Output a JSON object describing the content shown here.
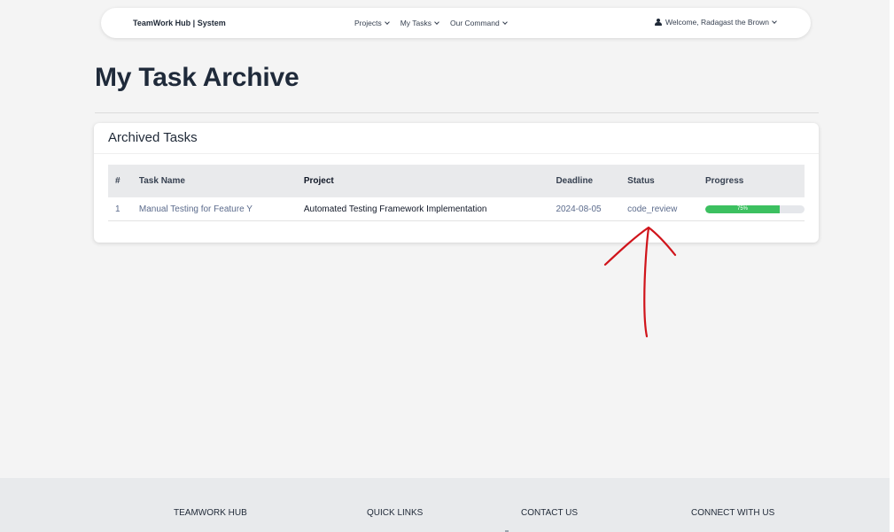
{
  "navbar": {
    "brand": "TeamWork Hub | System",
    "links": [
      "Projects",
      "My Tasks",
      "Our Command"
    ],
    "welcome": "Welcome, Radagast the Brown"
  },
  "page_title": "My Task Archive",
  "card": {
    "title": "Archived Tasks",
    "columns": [
      "#",
      "Task Name",
      "Project",
      "Deadline",
      "Status",
      "Progress"
    ],
    "rows": [
      {
        "num": "1",
        "task_name": "Manual Testing for Feature Y",
        "project": "Automated Testing Framework Implementation",
        "deadline": "2024-08-05",
        "status": "code_review",
        "progress_label": "75%",
        "progress_value": 0.75
      }
    ]
  },
  "footer": {
    "headings": [
      "TEAMWORK HUB",
      "QUICK LINKS",
      "CONTACT US",
      "CONNECT WITH US"
    ]
  },
  "colors": {
    "progress_fill": "#3cc060",
    "annotation_arrow": "#d0141b",
    "link_text": "#5b6b8c"
  }
}
